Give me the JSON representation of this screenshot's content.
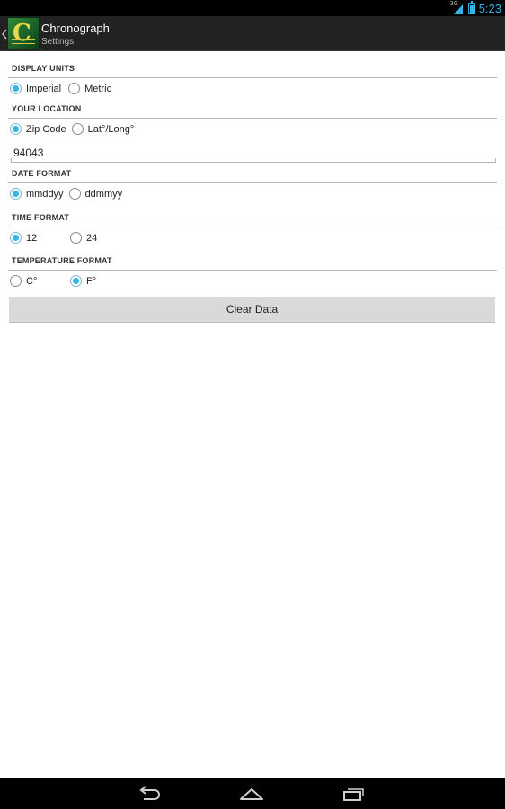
{
  "status_bar": {
    "network_type": "3G",
    "time": "5:23",
    "icons": [
      "signal-icon",
      "battery-icon"
    ]
  },
  "action_bar": {
    "title": "Chronograph",
    "subtitle": "Settings",
    "icons": [
      "up-caret-icon",
      "app-logo-icon"
    ]
  },
  "settings": {
    "display_units": {
      "header": "DISPLAY UNITS",
      "options": [
        {
          "label": "Imperial",
          "checked": true
        },
        {
          "label": "Metric",
          "checked": false
        }
      ]
    },
    "location": {
      "header": "YOUR LOCATION",
      "options": [
        {
          "label": "Zip Code",
          "checked": true
        },
        {
          "label": "Lat°/Long°",
          "checked": false
        }
      ],
      "zip_value": "94043"
    },
    "date_format": {
      "header": "DATE FORMAT",
      "options": [
        {
          "label": "mmddyy",
          "checked": true
        },
        {
          "label": "ddmmyy",
          "checked": false
        }
      ]
    },
    "time_format": {
      "header": "TIME FORMAT",
      "options": [
        {
          "label": "12",
          "checked": true
        },
        {
          "label": "24",
          "checked": false
        }
      ]
    },
    "temperature_format": {
      "header": "TEMPERATURE FORMAT",
      "options": [
        {
          "label": "C°",
          "checked": false
        },
        {
          "label": "F°",
          "checked": true
        }
      ]
    },
    "clear_button_label": "Clear Data"
  },
  "nav_bar": {
    "icons": [
      "back-icon",
      "home-icon",
      "recent-apps-icon"
    ]
  },
  "colors": {
    "accent": "#33b5e5",
    "action_bar": "#222222",
    "status_bar": "#000000",
    "button": "#d9d9d9"
  }
}
